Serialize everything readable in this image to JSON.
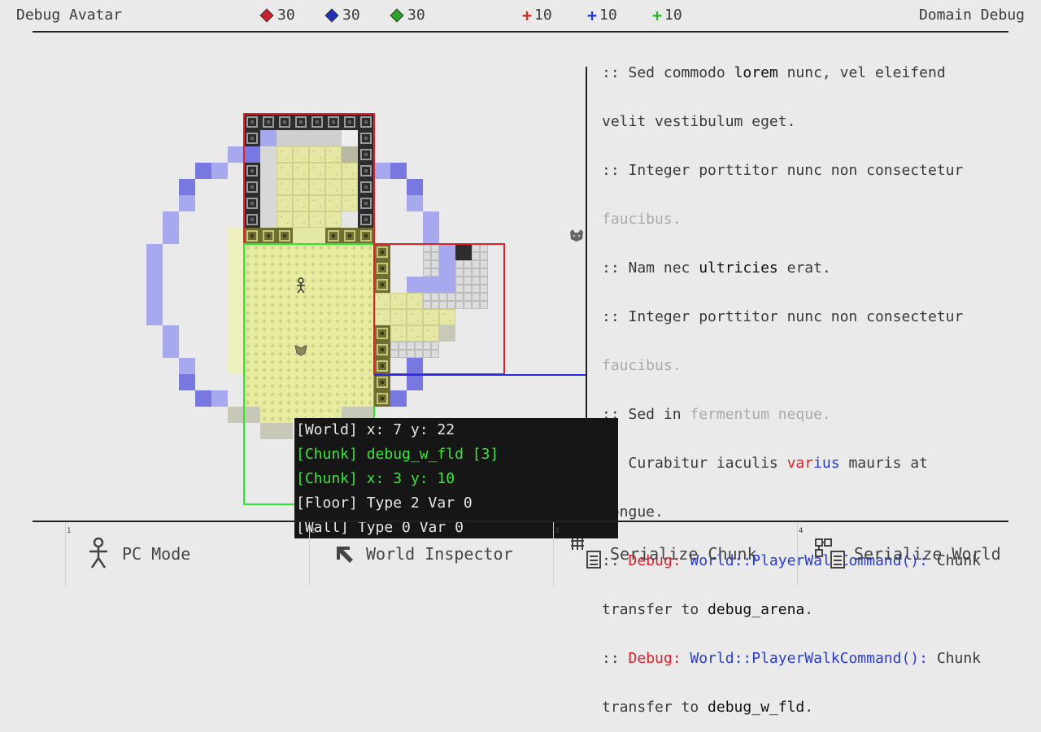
{
  "header": {
    "left_title": "Debug Avatar",
    "right_title": "Domain Debug",
    "stats": [
      {
        "icon": "red-diamond-icon",
        "color": "#cc1f2a",
        "value": "30"
      },
      {
        "icon": "blue-diamond-icon",
        "color": "#1f2fb8",
        "value": "30"
      },
      {
        "icon": "green-diamond-icon",
        "color": "#2aa52a",
        "value": "30"
      },
      {
        "icon": "red-plus-icon",
        "color": "#d82a2a",
        "value": "10"
      },
      {
        "icon": "blue-plus-icon",
        "color": "#2a3ad8",
        "value": "10"
      },
      {
        "icon": "green-plus-icon",
        "color": "#2ab82a",
        "value": "10"
      }
    ]
  },
  "log": {
    "l1a": ":: Sed commodo ",
    "l1b": "lorem",
    "l1c": " nunc, vel eleifend",
    "l2": "velit vestibulum eget.",
    "l3": ":: Integer porttitor nunc non consectetur",
    "l4": "faucibus.",
    "l5a": ":: Nam nec ",
    "l5b": "ultricies",
    "l5c": " erat.",
    "l6": ":: Integer porttitor nunc non consectetur",
    "l7": "faucibus.",
    "l8a": ":: Sed in ",
    "l8b": "fermentum neque.",
    "l9a": ":: Curabitur iaculis ",
    "l9b": "var",
    "l9c": "ius",
    "l9d": " mauris at",
    "l10": "congue.",
    "l11a": ":: ",
    "l11b": "Debug:",
    "l11c": " World::PlayerWalkCommand():",
    "l11d": " Chunk",
    "l12a": "transfer to ",
    "l12b": "debug_arena",
    "l12c": ".",
    "l13a": ":: ",
    "l13b": "Debug:",
    "l13c": " World::PlayerWalkCommand():",
    "l13d": " Chunk",
    "l14a": "transfer to ",
    "l14b": "debug_w_fld",
    "l14c": "."
  },
  "tooltip": {
    "world": "[World] x: 7 y: 22",
    "chunk_name": "[Chunk] debug_w_fld [3]",
    "chunk_pos": "[Chunk] x: 3 y: 10",
    "floor": "[Floor] Type 2 Var 0",
    "wall": "[Wall] Type 0 Var 0"
  },
  "toolbar": [
    {
      "num": "1",
      "label": "PC Mode",
      "icon": "person-icon"
    },
    {
      "num": "2",
      "label": "World Inspector",
      "icon": "cursor-arrow-icon"
    },
    {
      "num": "3",
      "label": "Serialize Chunk",
      "icon": "grid-document-icon"
    },
    {
      "num": "4",
      "label": "Serialize World",
      "icon": "tree-document-icon"
    }
  ]
}
